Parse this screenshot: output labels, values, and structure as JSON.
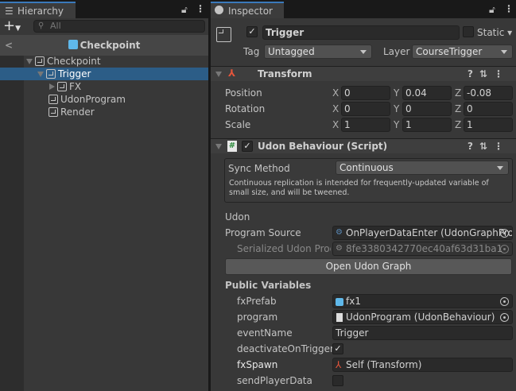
{
  "hierarchy": {
    "tab": "Hierarchy",
    "search_placeholder": "All",
    "scene": "Checkpoint",
    "items": [
      {
        "label": "Checkpoint"
      },
      {
        "label": "Trigger"
      },
      {
        "label": "FX"
      },
      {
        "label": "UdonProgram"
      },
      {
        "label": "Render"
      }
    ]
  },
  "inspector": {
    "tab": "Inspector",
    "object_name": "Trigger",
    "static_label": "Static",
    "tag_label": "Tag",
    "tag_value": "Untagged",
    "layer_label": "Layer",
    "layer_value": "CourseTrigger",
    "transform": {
      "title": "Transform",
      "rows": [
        {
          "label": "Position",
          "x": "0",
          "y": "0.04",
          "z": "-0.08"
        },
        {
          "label": "Rotation",
          "x": "0",
          "y": "0",
          "z": "0"
        },
        {
          "label": "Scale",
          "x": "1",
          "y": "1",
          "z": "1"
        }
      ],
      "axes": {
        "x": "X",
        "y": "Y",
        "z": "Z"
      }
    },
    "udon": {
      "title": "Udon Behaviour (Script)",
      "sync_label": "Sync Method",
      "sync_value": "Continuous",
      "sync_help": "Continuous replication is intended for frequently-updated variable of small size, and will be tweened.",
      "section": "Udon",
      "program_source_label": "Program Source",
      "program_source_value": "OnPlayerDataEnter (UdonGraphProgramAsset)",
      "serialized_label": "Serialized Udon Program Asset",
      "serialized_value": "8fe3380342770ec40af63d31ba1",
      "open_graph": "Open Udon Graph",
      "public_vars_title": "Public Variables",
      "vars": [
        {
          "label": "fxPrefab",
          "value": "fx1"
        },
        {
          "label": "program",
          "value": "UdonProgram (UdonBehaviour)"
        },
        {
          "label": "eventName",
          "value": "Trigger"
        },
        {
          "label": "deactivateOnTrigger",
          "checked": true
        },
        {
          "label": "fxSpawn",
          "value": "Self (Transform)"
        },
        {
          "label": "sendPlayerData",
          "checked": false
        }
      ]
    }
  }
}
